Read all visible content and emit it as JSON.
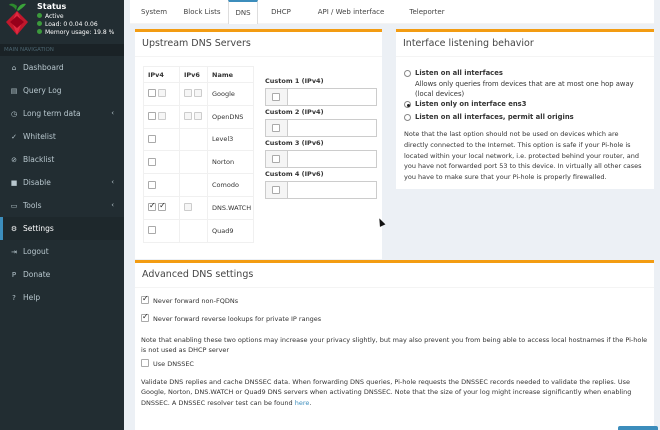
{
  "sidebar": {
    "status": {
      "title": "Status",
      "active": "Active",
      "load": "Load:  0  0.04  0.06",
      "memory": "Memory usage:  19.8 %"
    },
    "nav_header": "MAIN NAVIGATION",
    "items": [
      {
        "label": "Dashboard",
        "icon": "home-icon"
      },
      {
        "label": "Query Log",
        "icon": "file-icon"
      },
      {
        "label": "Long term data",
        "icon": "history-icon"
      },
      {
        "label": "Whitelist",
        "icon": "check-circle-icon"
      },
      {
        "label": "Blacklist",
        "icon": "ban-icon"
      },
      {
        "label": "Disable",
        "icon": "stop-icon"
      },
      {
        "label": "Tools",
        "icon": "folder-icon"
      },
      {
        "label": "Settings",
        "icon": "gears-icon"
      },
      {
        "label": "Logout",
        "icon": "user-logout-icon"
      },
      {
        "label": "Donate",
        "icon": "paypal-icon"
      },
      {
        "label": "Help",
        "icon": "question-icon"
      }
    ]
  },
  "tabs": [
    "System",
    "Block Lists",
    "DNS",
    "DHCP",
    "API / Web interface",
    "Teleporter"
  ],
  "active_tab": "DNS",
  "upstream": {
    "title": "Upstream DNS Servers",
    "headers": [
      "IPv4",
      "IPv6",
      "Name"
    ],
    "servers": [
      {
        "name": "Google",
        "ipv4": false,
        "ipv6": false,
        "has_ipv6": true
      },
      {
        "name": "OpenDNS",
        "ipv4": false,
        "ipv6": false,
        "has_ipv6": true
      },
      {
        "name": "Level3",
        "ipv4": false,
        "ipv6": false,
        "has_ipv6": false
      },
      {
        "name": "Norton",
        "ipv4": false,
        "ipv6": false,
        "has_ipv6": false
      },
      {
        "name": "Comodo",
        "ipv4": false,
        "ipv6": false,
        "has_ipv6": false
      },
      {
        "name": "DNS.WATCH",
        "ipv4": true,
        "ipv6": true,
        "has_ipv6": true
      },
      {
        "name": "Quad9",
        "ipv4": false,
        "ipv6": false,
        "has_ipv6": false
      }
    ],
    "custom": [
      {
        "label": "Custom 1 (IPv4)",
        "value": ""
      },
      {
        "label": "Custom 2 (IPv4)",
        "value": ""
      },
      {
        "label": "Custom 3 (IPv6)",
        "value": ""
      },
      {
        "label": "Custom 4 (IPv6)",
        "value": ""
      }
    ]
  },
  "interface": {
    "title": "Interface listening behavior",
    "options": [
      {
        "label": "Listen on all interfaces",
        "desc": "Allows only queries from devices that are at most one hop away (local devices)",
        "selected": false
      },
      {
        "label": "Listen only on interface ens3",
        "desc": "",
        "selected": true
      },
      {
        "label": "Listen on all interfaces, permit all origins",
        "desc": "",
        "selected": false
      }
    ],
    "note": "Note that the last option should not be used on devices which are directly connected to the Internet. This option is safe if your Pi-hole is located within your local network, i.e. protected behind your router, and you have not forwarded port 53 to this device. In virtually all other cases you have to make sure that your Pi-hole is properly firewalled."
  },
  "advanced": {
    "title": "Advanced DNS settings",
    "fqdn_label": "Never forward non-FQDNs",
    "fqdn_checked": true,
    "private_label": "Never forward reverse lookups for private IP ranges",
    "private_checked": true,
    "note1": "Note that enabling these two options may increase your privacy slightly, but may also prevent you from being able to access local hostnames if the Pi-hole is not used as DHCP server",
    "dnssec_label": "Use DNSSEC",
    "dnssec_checked": false,
    "note2": "Validate DNS replies and cache DNSSEC data. When forwarding DNS queries, Pi-hole requests the DNSSEC records needed to validate the replies. Use Google, Norton, DNS.WATCH or Quad9 DNS servers when activating DNSSEC. Note that the size of your log might increase significantly when enabling DNSSEC. A DNSSEC resolver test can be found",
    "link_text": "here",
    "link_tail": "."
  },
  "colors": {
    "accent": "#3c8dbc",
    "panel_border": "#f39c12",
    "sidebar": "#222d32",
    "status_dot": "#3c9a3c"
  }
}
